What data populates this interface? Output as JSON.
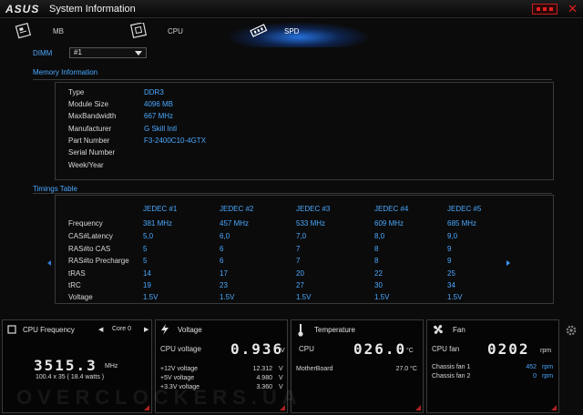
{
  "window": {
    "logo": "ASUS",
    "title": "System Information"
  },
  "tabs": [
    {
      "label": "MB",
      "icon": "motherboard-icon"
    },
    {
      "label": "CPU",
      "icon": "cpu-chip-icon"
    },
    {
      "label": "SPD",
      "icon": "memory-module-icon",
      "active": true
    }
  ],
  "dimm": {
    "label": "DIMM",
    "selected": "#1"
  },
  "memory_info": {
    "title": "Memory Information",
    "rows": [
      {
        "key": "Type",
        "value": "DDR3"
      },
      {
        "key": "Module Size",
        "value": "4096 MB"
      },
      {
        "key": "MaxBandwidth",
        "value": "667 MHz"
      },
      {
        "key": "Manufacturer",
        "value": "G Skill Intl"
      },
      {
        "key": "Part Number",
        "value": "F3-2400C10-4GTX"
      },
      {
        "key": "Serial Number",
        "value": ""
      },
      {
        "key": "Week/Year",
        "value": ""
      }
    ]
  },
  "timings": {
    "title": "Timings Table",
    "columns": [
      "JEDEC #1",
      "JEDEC #2",
      "JEDEC #3",
      "JEDEC #4",
      "JEDEC #5"
    ],
    "rows": [
      {
        "key": "Frequency",
        "values": [
          "381 MHz",
          "457 MHz",
          "533 MHz",
          "609 MHz",
          "685 MHz"
        ]
      },
      {
        "key": "CAS#Latency",
        "values": [
          "5,0",
          "6,0",
          "7,0",
          "8,0",
          "9,0"
        ]
      },
      {
        "key": "RAS#to CAS",
        "values": [
          "5",
          "6",
          "7",
          "8",
          "9"
        ]
      },
      {
        "key": "RAS#to Precharge",
        "values": [
          "5",
          "6",
          "7",
          "8",
          "9"
        ]
      },
      {
        "key": "tRAS",
        "values": [
          "14",
          "17",
          "20",
          "22",
          "25"
        ]
      },
      {
        "key": "tRC",
        "values": [
          "19",
          "23",
          "27",
          "30",
          "34"
        ]
      },
      {
        "key": "Voltage",
        "values": [
          "1.5V",
          "1.5V",
          "1.5V",
          "1.5V",
          "1.5V"
        ]
      }
    ]
  },
  "cpu_freq": {
    "title": "CPU Frequency",
    "core": "Core 0",
    "value": "3515.3",
    "unit": "MHz",
    "detail": "100.4  x  35  ( 18.4     watts )"
  },
  "voltage": {
    "title": "Voltage",
    "main_label": "CPU voltage",
    "main_value": "0.936",
    "main_unit": "V",
    "rows": [
      {
        "label": "+12V voltage",
        "value": "12.312",
        "unit": "V"
      },
      {
        "label": "+5V voltage",
        "value": "4.980",
        "unit": "V"
      },
      {
        "label": "+3.3V voltage",
        "value": "3.360",
        "unit": "V"
      }
    ]
  },
  "temperature": {
    "title": "Temperature",
    "main_label": "CPU",
    "main_value": "026.0",
    "main_unit": "°C",
    "rows": [
      {
        "label": "MotherBoard",
        "value": "27.0 °C"
      }
    ]
  },
  "fan": {
    "title": "Fan",
    "main_label": "CPU fan",
    "main_value": "0202",
    "main_unit": "rpm",
    "rows": [
      {
        "label": "Chassis fan 1",
        "value": "452",
        "unit": "rpm"
      },
      {
        "label": "Chassis fan 2",
        "value": "0",
        "unit": "rpm"
      }
    ]
  },
  "watermark": "OVERCLOCKERS.UA",
  "colors": {
    "accent": "#4aa8ff",
    "alert": "#e02020",
    "glow": "#2882ff"
  }
}
